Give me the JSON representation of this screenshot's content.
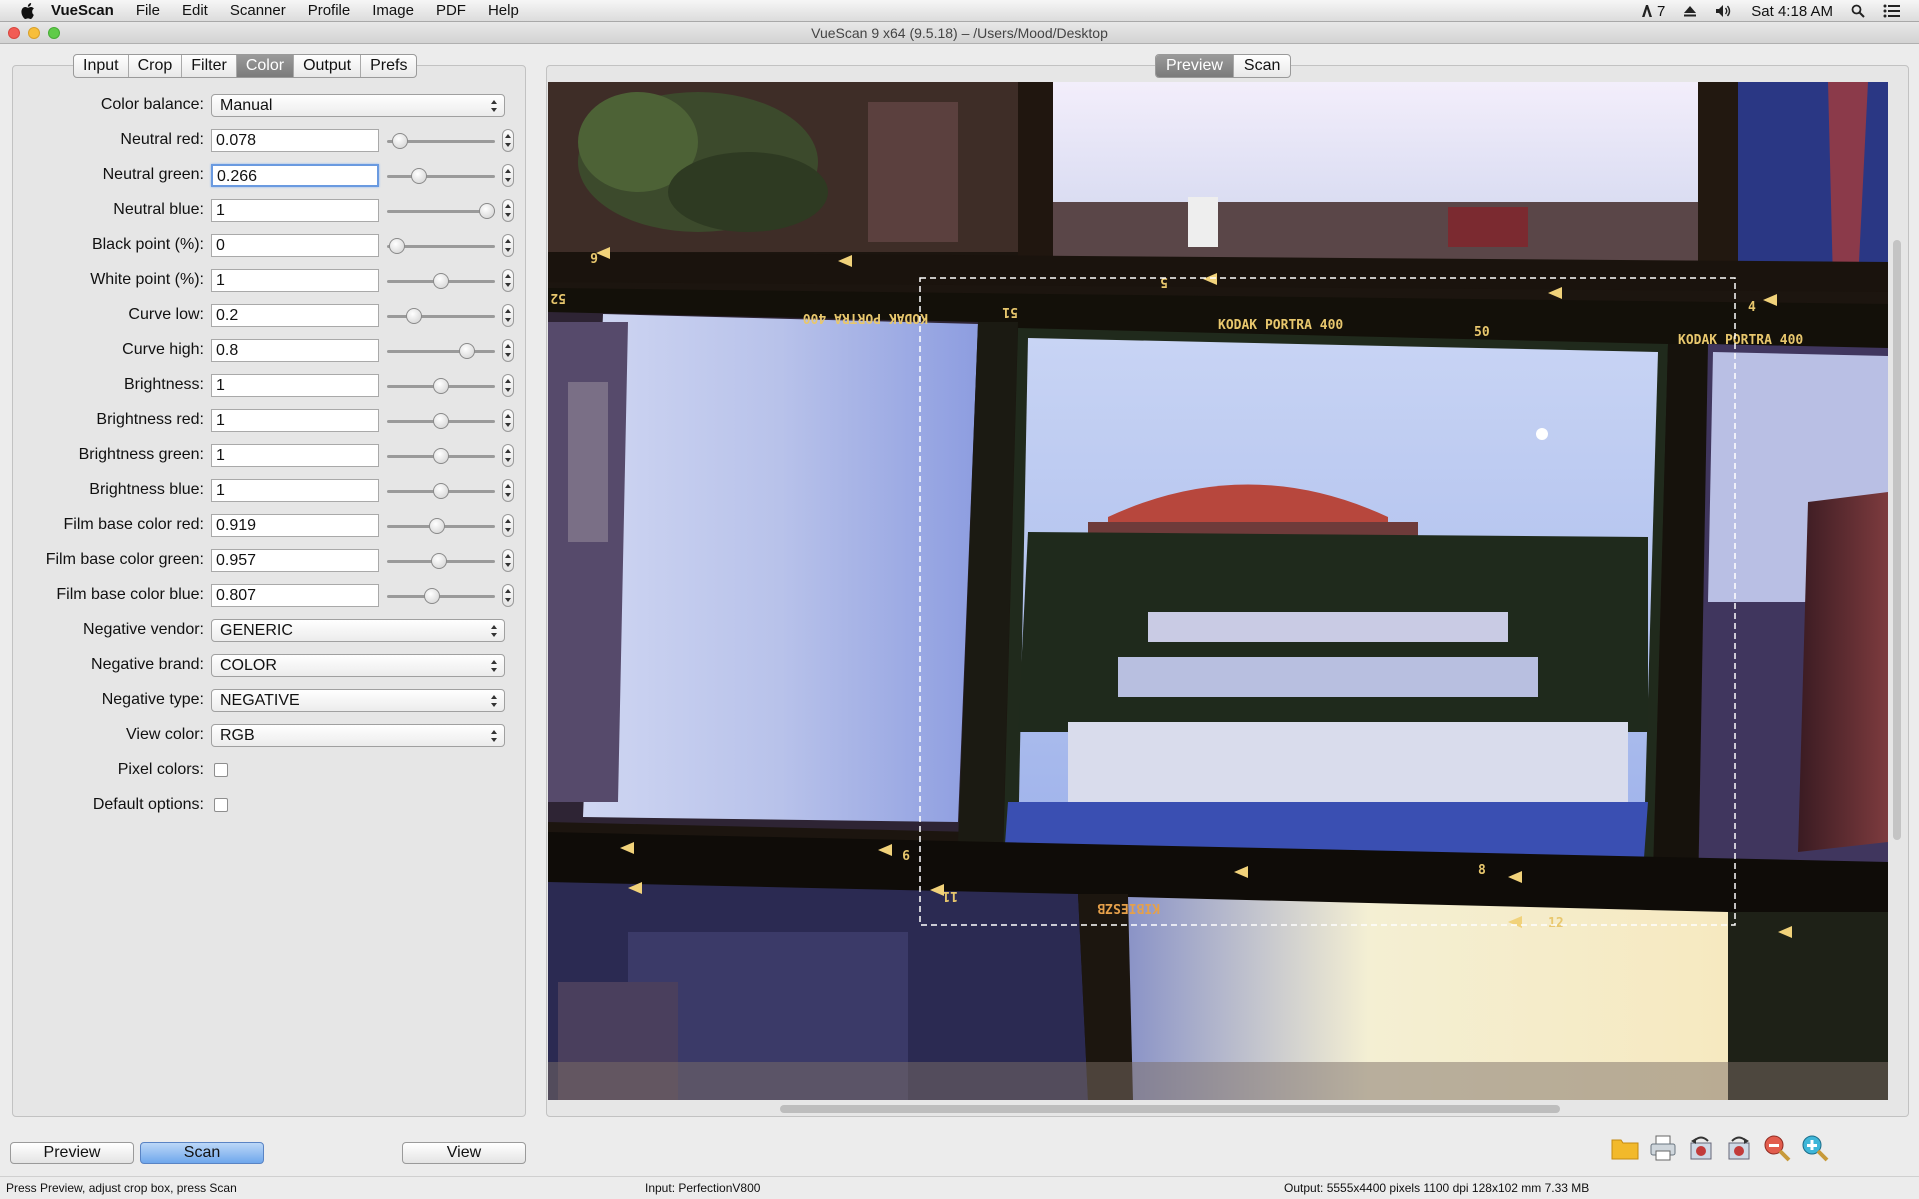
{
  "menubar": {
    "app_name": "VueScan",
    "items": [
      "File",
      "Edit",
      "Scanner",
      "Profile",
      "Image",
      "PDF",
      "Help"
    ],
    "status_number": "7",
    "clock": "Sat 4:18 AM"
  },
  "window": {
    "title": "VueScan 9 x64 (9.5.18) – /Users/Mood/Desktop"
  },
  "left_tabs": [
    "Input",
    "Crop",
    "Filter",
    "Color",
    "Output",
    "Prefs"
  ],
  "active_left_tab": "Color",
  "right_tabs": [
    "Preview",
    "Scan"
  ],
  "active_right_tab": "Preview",
  "color_settings": {
    "color_balance": {
      "label": "Color balance:",
      "value": "Manual"
    },
    "neutral_red": {
      "label": "Neutral red:",
      "value": "0.078",
      "slider_fraction": 0.12
    },
    "neutral_green": {
      "label": "Neutral green:",
      "value": "0.266",
      "slider_fraction": 0.3
    },
    "neutral_blue": {
      "label": "Neutral blue:",
      "value": "1",
      "slider_fraction": 0.93
    },
    "black_point": {
      "label": "Black point (%):",
      "value": "0",
      "slider_fraction": 0.09
    },
    "white_point": {
      "label": "White point (%):",
      "value": "1",
      "slider_fraction": 0.5
    },
    "curve_low": {
      "label": "Curve low:",
      "value": "0.2",
      "slider_fraction": 0.25
    },
    "curve_high": {
      "label": "Curve high:",
      "value": "0.8",
      "slider_fraction": 0.74
    },
    "brightness": {
      "label": "Brightness:",
      "value": "1",
      "slider_fraction": 0.5
    },
    "brightness_red": {
      "label": "Brightness red:",
      "value": "1",
      "slider_fraction": 0.5
    },
    "brightness_green": {
      "label": "Brightness green:",
      "value": "1",
      "slider_fraction": 0.5
    },
    "brightness_blue": {
      "label": "Brightness blue:",
      "value": "1",
      "slider_fraction": 0.5
    },
    "film_base_red": {
      "label": "Film base color red:",
      "value": "0.919",
      "slider_fraction": 0.46
    },
    "film_base_green": {
      "label": "Film base color green:",
      "value": "0.957",
      "slider_fraction": 0.48
    },
    "film_base_blue": {
      "label": "Film base color blue:",
      "value": "0.807",
      "slider_fraction": 0.42
    },
    "negative_vendor": {
      "label": "Negative vendor:",
      "value": "GENERIC"
    },
    "negative_brand": {
      "label": "Negative brand:",
      "value": "COLOR"
    },
    "negative_type": {
      "label": "Negative type:",
      "value": "NEGATIVE"
    },
    "view_color": {
      "label": "View color:",
      "value": "RGB"
    },
    "pixel_colors": {
      "label": "Pixel colors:",
      "checked": false
    },
    "default_options": {
      "label": "Default options:",
      "checked": false
    }
  },
  "film_labels": {
    "kodak_portra": "KODAK PORTRA 400",
    "frame_51": "51",
    "frame_50": "50",
    "frame_52": "52",
    "frame_5": "5",
    "frame_6": "6",
    "frame_4": "4",
    "frame_8": "8",
    "frame_9": "9",
    "frame_11": "11",
    "frame_12": "12",
    "edge_code": "KIBIESZB"
  },
  "bottom_buttons": {
    "preview": "Preview",
    "scan": "Scan",
    "view": "View"
  },
  "status": {
    "hint": "Press Preview, adjust crop box, press Scan",
    "input": "Input: PerfectionV800",
    "output": "Output: 5555x4400 pixels 1100 dpi 128x102 mm 7.33 MB"
  }
}
